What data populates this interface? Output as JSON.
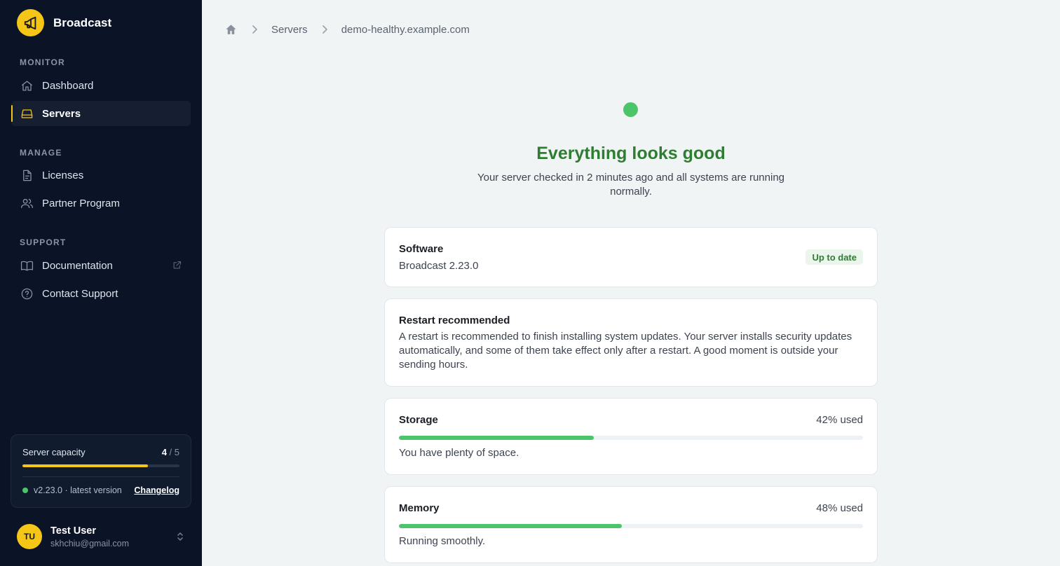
{
  "brand": {
    "name": "Broadcast",
    "accent": "#f5c518"
  },
  "sidebar": {
    "sections": [
      {
        "label": "MONITOR",
        "items": [
          {
            "label": "Dashboard",
            "icon": "home-icon"
          },
          {
            "label": "Servers",
            "icon": "server-icon",
            "active": true
          }
        ]
      },
      {
        "label": "MANAGE",
        "items": [
          {
            "label": "Licenses",
            "icon": "document-icon"
          },
          {
            "label": "Partner Program",
            "icon": "users-icon"
          }
        ]
      },
      {
        "label": "SUPPORT",
        "items": [
          {
            "label": "Documentation",
            "icon": "book-icon",
            "external": true
          },
          {
            "label": "Contact Support",
            "icon": "help-circle-icon"
          }
        ]
      }
    ],
    "capacity": {
      "title": "Server capacity",
      "used": "4",
      "separator": " / ",
      "total": "5",
      "fraction": 0.8,
      "version": "v2.23.0 · latest version",
      "changelog_label": "Changelog"
    },
    "user": {
      "initials": "TU",
      "name": "Test User",
      "email": "skhchiu@gmail.com"
    }
  },
  "breadcrumb": {
    "home_icon": "home-icon",
    "items": [
      "Servers",
      "demo-healthy.example.com"
    ]
  },
  "status": {
    "title": "Everything looks good",
    "subtitle": "Your server checked in 2 minutes ago and all systems are running normally.",
    "color": "#4cc46a"
  },
  "cards": {
    "software": {
      "title": "Software",
      "value": "Broadcast 2.23.0",
      "badge": "Up to date"
    },
    "restart": {
      "title": "Restart recommended",
      "text": "A restart is recommended to finish installing system updates. Your server installs security updates automatically, and some of them take effect only after a restart. A good moment is outside your sending hours."
    },
    "storage": {
      "title": "Storage",
      "usage": "42% used",
      "percent": 42,
      "note": "You have plenty of space."
    },
    "memory": {
      "title": "Memory",
      "usage": "48% used",
      "percent": 48,
      "note": "Running smoothly."
    }
  }
}
